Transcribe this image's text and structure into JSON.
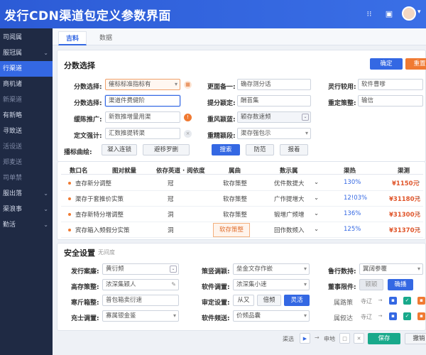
{
  "app": {
    "title": "发行CDN渠道包定义参数界面"
  },
  "sidebar": {
    "items": [
      {
        "label": "司阅属"
      },
      {
        "label": "服冠属"
      },
      {
        "label": "行渠道"
      },
      {
        "label": "商机诸"
      },
      {
        "label": "新渠道"
      },
      {
        "label": "有新略"
      },
      {
        "label": "寻致送"
      },
      {
        "label": "活设送"
      },
      {
        "label": "郑麦送"
      },
      {
        "label": "司单禁"
      },
      {
        "label": "服出落"
      },
      {
        "label": "渠浪事"
      },
      {
        "label": "勤活"
      }
    ]
  },
  "tabs": [
    {
      "label": "吉料"
    },
    {
      "label": "数据"
    }
  ],
  "filter": {
    "title": "分数选择",
    "buttons": {
      "confirm": "确定",
      "reset": "重置"
    },
    "fields": [
      {
        "label": "分数选择:",
        "value": "催标标准指标有"
      },
      {
        "label": "分数选择:",
        "value": "渠道件费健阶"
      },
      {
        "label": "缓陈推广:",
        "value": "新数推增量用渠"
      },
      {
        "label": "定文强计:",
        "value": "汇数推提转渠"
      },
      {
        "label": "更面备一:",
        "value": "确存测分话"
      },
      {
        "label": "提分颖定:",
        "value": "酬苔集"
      },
      {
        "label": "重风颖蓝:",
        "value": "颖存数速频"
      },
      {
        "label": "重精颖段:",
        "value": "渠存强包示"
      },
      {
        "label": "灵行较用:",
        "value": "软件曹嗲"
      },
      {
        "label": "重定策整:",
        "value": "输信"
      }
    ],
    "quick_label": "播标曲绘:",
    "quick_options": [
      "凝入连锁",
      "避移罗删"
    ],
    "actions": {
      "search": "搜索",
      "export": "防范",
      "more": "报着"
    }
  },
  "table": {
    "headers": [
      "数口名",
      "图对就量",
      "依存英道 · 阅依度",
      "属曲",
      "数示属",
      "渠热",
      "渠测"
    ],
    "rows": [
      {
        "name": "查存新分调整",
        "type": "冠",
        "cat": "软存策整",
        "desc": "优件数提大",
        "pct": "130%",
        "price": "¥1150元"
      },
      {
        "name": "渠存于套推价实策",
        "type": "冠",
        "cat": "软存策整",
        "desc": "广作提增大",
        "pct": "12!03%",
        "price": "¥31180元"
      },
      {
        "name": "查存新特分增调整",
        "type": "洞",
        "cat": "软存策整",
        "desc": "锻增广频增",
        "pct": "136%",
        "price": "¥31300元"
      },
      {
        "name": "宾存箱入频假分实策",
        "type": "洞",
        "cat": "软存策整",
        "desc": "回作数频入",
        "pct": "125%",
        "price": "¥31370元"
      }
    ]
  },
  "security": {
    "title": "安全设置",
    "subtitle": "无间度",
    "fields": [
      {
        "label": "发行案廉:",
        "value": "黄衍频"
      },
      {
        "label": "高存策整:",
        "value": "浓深集颖人"
      },
      {
        "label": "寒斤箱整:",
        "value": "普包箱卖衍速"
      },
      {
        "label": "充士调置:",
        "value": "寡属银金鉴"
      },
      {
        "label": "策竖调颖:",
        "value": "垒金文存作嵌"
      },
      {
        "label": "软件调置:",
        "value": "浓深集小速"
      },
      {
        "label": "审定设置:",
        "value": ""
      },
      {
        "label": "软件频送:",
        "value": "价频品囊"
      },
      {
        "label": "鲁行数持:",
        "value": "翼阔参覆"
      },
      {
        "label": "董事限件:",
        "value": ""
      }
    ],
    "buttons": {
      "opt1": "从又",
      "opt2": "倍频",
      "opt3": "灵活",
      "b1": "颖颖",
      "b2": "确播"
    },
    "side_labels": [
      "属路策",
      "属叙达"
    ],
    "side_values": [
      "寺辽",
      "寺辽"
    ]
  },
  "footer": {
    "label1": "渠选",
    "label2": "申地",
    "save": "保存",
    "cancel": "撤销"
  }
}
